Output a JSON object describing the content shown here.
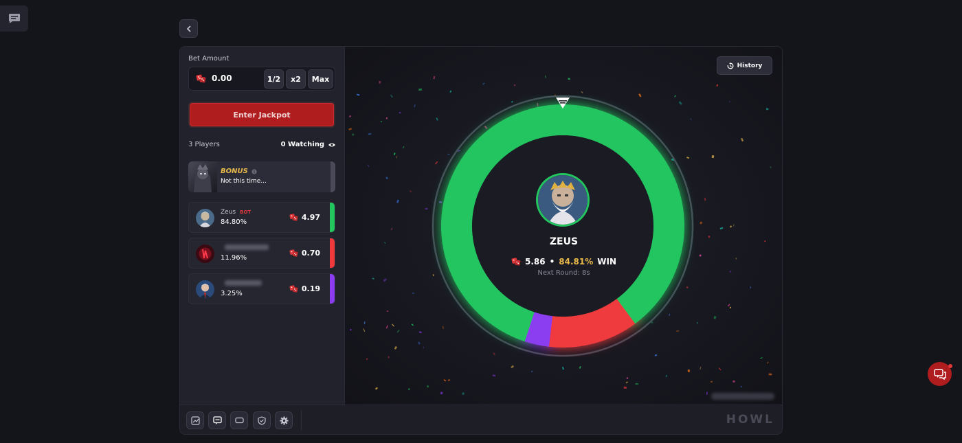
{
  "nav": {
    "chat_icon": "chat-icon",
    "back_icon": "chevron-left-icon"
  },
  "bet": {
    "label": "Bet Amount",
    "value": "0.00",
    "half_label": "1/2",
    "double_label": "x2",
    "max_label": "Max",
    "chip_icon": "dice-chip-icon"
  },
  "enter_button": "Enter Jackpot",
  "players_count": "3 Players",
  "watching": {
    "count": "0 Watching",
    "icon": "eye-icon"
  },
  "bonus": {
    "title": "BONUS",
    "subtitle": "Not this time...",
    "info_icon": "info-icon"
  },
  "players": [
    {
      "name": "Zeus",
      "badge": "BOT",
      "percent": "84.80%",
      "amount": "4.97",
      "color": "#22c55e"
    },
    {
      "name": "",
      "badge": "",
      "percent": "11.96%",
      "amount": "0.70",
      "color": "#ef3a3d"
    },
    {
      "name": "",
      "badge": "",
      "percent": "3.25%",
      "amount": "0.19",
      "color": "#8b3cf0"
    }
  ],
  "history_button": "History",
  "winner": {
    "name": "ZEUS",
    "amount": "5.86",
    "separator": "•",
    "percent": "84.81%",
    "result": "WIN",
    "next_round": "Next Round: 8s"
  },
  "wheel_shares": [
    {
      "player": "Zeus",
      "share": 0.848,
      "color": "#22c55e"
    },
    {
      "player": "player-2",
      "share": 0.1196,
      "color": "#ef3a3d"
    },
    {
      "player": "player-3",
      "share": 0.0325,
      "color": "#8b3cf0"
    }
  ],
  "toolbar": {
    "icons": [
      "stats-icon",
      "chat-bubble-icon",
      "ticket-icon",
      "shield-icon",
      "gear-icon"
    ]
  },
  "brand": "HOWL",
  "colors": {
    "accent": "#b01d1f",
    "win": "#22c55e",
    "bonus": "#e8b84a"
  }
}
